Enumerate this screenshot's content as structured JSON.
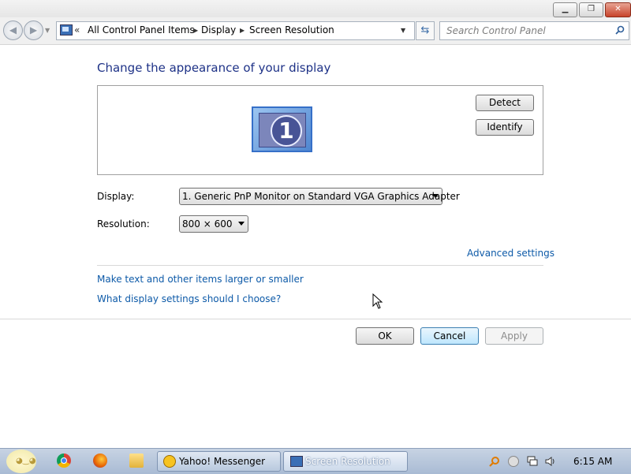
{
  "window": {
    "minimize_glyph": "▁",
    "maximize_glyph": "❐",
    "close_glyph": "✕"
  },
  "nav": {
    "chevron": "«",
    "breadcrumbs": [
      {
        "label": "All Control Panel Items"
      },
      {
        "label": "Display"
      },
      {
        "label": "Screen Resolution"
      }
    ],
    "search_placeholder": "Search Control Panel"
  },
  "main": {
    "heading": "Change the appearance of your display",
    "monitor_number": "1",
    "detect_label": "Detect",
    "identify_label": "Identify",
    "display_label": "Display:",
    "display_value": "1. Generic PnP Monitor on Standard VGA Graphics Adapter",
    "resolution_label": "Resolution:",
    "resolution_value": "800 × 600",
    "advanced_link": "Advanced settings",
    "larger_link": "Make text and other items larger or smaller",
    "choose_link": "What display settings should I choose?",
    "ok_label": "OK",
    "cancel_label": "Cancel",
    "apply_label": "Apply"
  },
  "taskbar": {
    "tasks": [
      {
        "label": "Yahoo! Messenger"
      },
      {
        "label": "Screen Resolution"
      }
    ],
    "clock": "6:15 AM"
  },
  "colors": {
    "heading": "#1e3287",
    "link": "#0d5aa8",
    "accent": "#3c7fb1"
  },
  "icons": {
    "nav": [
      "back-icon",
      "forward-icon",
      "control-panel-icon",
      "refresh-icon",
      "search-icon"
    ],
    "taskbar": [
      "start-orb-icon",
      "chrome-icon",
      "firefox-icon",
      "folder-icon",
      "yahoo-icon",
      "screen-resolution-icon"
    ],
    "tray": [
      "search-tray-icon",
      "yahoo-tray-icon",
      "network-icon",
      "volume-icon"
    ]
  }
}
